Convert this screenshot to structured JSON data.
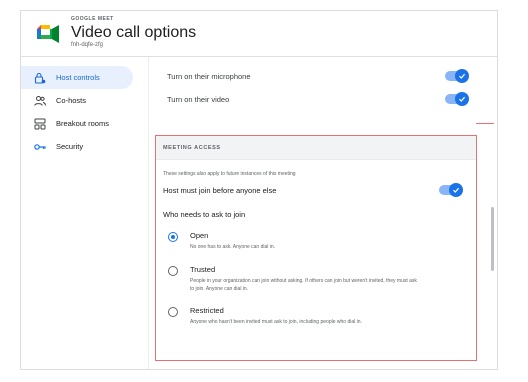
{
  "header": {
    "app_name": "GOOGLE MEET",
    "title": "Video call options",
    "meeting_code": "fnh-dqfe-zfg",
    "logo_icon": "google-meet-icon"
  },
  "sidebar": {
    "items": [
      {
        "label": "Host controls",
        "icon": "lock-person-icon",
        "active": true
      },
      {
        "label": "Co-hosts",
        "icon": "people-icon",
        "active": false
      },
      {
        "label": "Breakout rooms",
        "icon": "grid-icon",
        "active": false
      },
      {
        "label": "Security",
        "icon": "key-icon",
        "active": false
      }
    ]
  },
  "controls": {
    "microphone": {
      "label": "Turn on their microphone",
      "on": true
    },
    "video": {
      "label": "Turn on their video",
      "on": true
    }
  },
  "access": {
    "section_label": "MEETING ACCESS",
    "note": "These settings also apply to future instances of this meeting",
    "must_join": {
      "label": "Host must join before anyone else",
      "on": true
    },
    "who_label": "Who needs to ask to join",
    "options": [
      {
        "title": "Open",
        "desc": "No one has to ask. Anyone can dial in.",
        "selected": true
      },
      {
        "title": "Trusted",
        "desc": "People in your organization can join without asking. If others can join but weren't invited, they must ask to join. Anyone can dial in.",
        "selected": false
      },
      {
        "title": "Restricted",
        "desc": "Anyone who hasn't been invited must ask to join, including people who dial in.",
        "selected": false
      }
    ]
  },
  "colors": {
    "accent": "#1a73e8",
    "active_bg": "#e8f0fe",
    "highlight_border": "#e57373"
  }
}
